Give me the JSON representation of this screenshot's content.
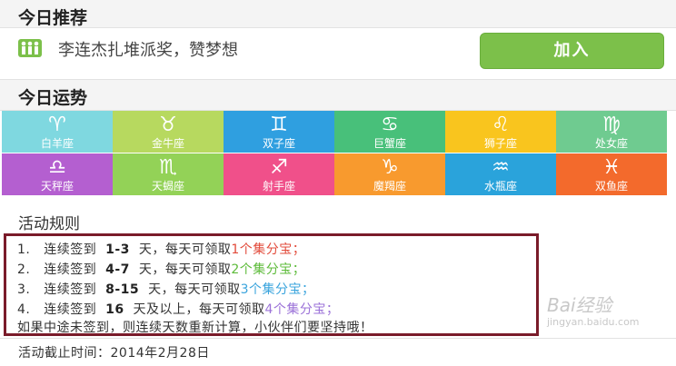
{
  "recommend": {
    "title": "今日推荐",
    "text": "李连杰扎堆派奖，赞梦想",
    "join_label": "加入",
    "accent": "#7cc04a"
  },
  "fortune": {
    "title": "今日运势",
    "signs": [
      {
        "name": "白羊座",
        "glyph": "♈",
        "color": "#7fd8e0",
        "icon": "aries-icon"
      },
      {
        "name": "金牛座",
        "glyph": "♉",
        "color": "#b7d95f",
        "icon": "taurus-icon"
      },
      {
        "name": "双子座",
        "glyph": "♊",
        "color": "#2f9fe0",
        "icon": "gemini-icon"
      },
      {
        "name": "巨蟹座",
        "glyph": "♋",
        "color": "#48c07a",
        "icon": "cancer-icon"
      },
      {
        "name": "狮子座",
        "glyph": "♌",
        "color": "#f9c51e",
        "icon": "leo-icon"
      },
      {
        "name": "处女座",
        "glyph": "♍",
        "color": "#6fcb90",
        "icon": "virgo-icon"
      },
      {
        "name": "天秤座",
        "glyph": "♎",
        "color": "#b45fd0",
        "icon": "libra-icon"
      },
      {
        "name": "天蝎座",
        "glyph": "♏",
        "color": "#93d257",
        "icon": "scorpio-icon"
      },
      {
        "name": "射手座",
        "glyph": "♐",
        "color": "#f0508a",
        "icon": "sagittarius-icon"
      },
      {
        "name": "魔羯座",
        "glyph": "♑",
        "color": "#f89a2e",
        "icon": "capricorn-icon"
      },
      {
        "name": "水瓶座",
        "glyph": "♒",
        "color": "#2aa3db",
        "icon": "aquarius-icon"
      },
      {
        "name": "双鱼座",
        "glyph": "♓",
        "color": "#f36a2c",
        "icon": "pisces-icon"
      }
    ]
  },
  "rules": {
    "title": "活动规则",
    "items": [
      {
        "num": "1.",
        "pre": "连续签到",
        "range": "1-3",
        "mid": "天，每天可领取",
        "reward": "1个集分宝；",
        "color": "red"
      },
      {
        "num": "2.",
        "pre": "连续签到",
        "range": "4-7",
        "mid": "天，每天可领取",
        "reward": "2个集分宝；",
        "color": "green"
      },
      {
        "num": "3.",
        "pre": "连续签到",
        "range": "8-15",
        "mid": "天，每天可领取",
        "reward": "3个集分宝；",
        "color": "blue"
      },
      {
        "num": "4.",
        "pre": "连续签到",
        "range": "16",
        "mid": "天及以上，每天可领取",
        "reward": "4个集分宝；",
        "color": "purple"
      }
    ],
    "note": "如果中途未签到，则连续天数重新计算，小伙伴们要坚持哦！"
  },
  "end_date": "活动截止时间：2014年2月28日",
  "watermark": {
    "main": "Bai经验",
    "url": "jingyan.baidu.com"
  }
}
